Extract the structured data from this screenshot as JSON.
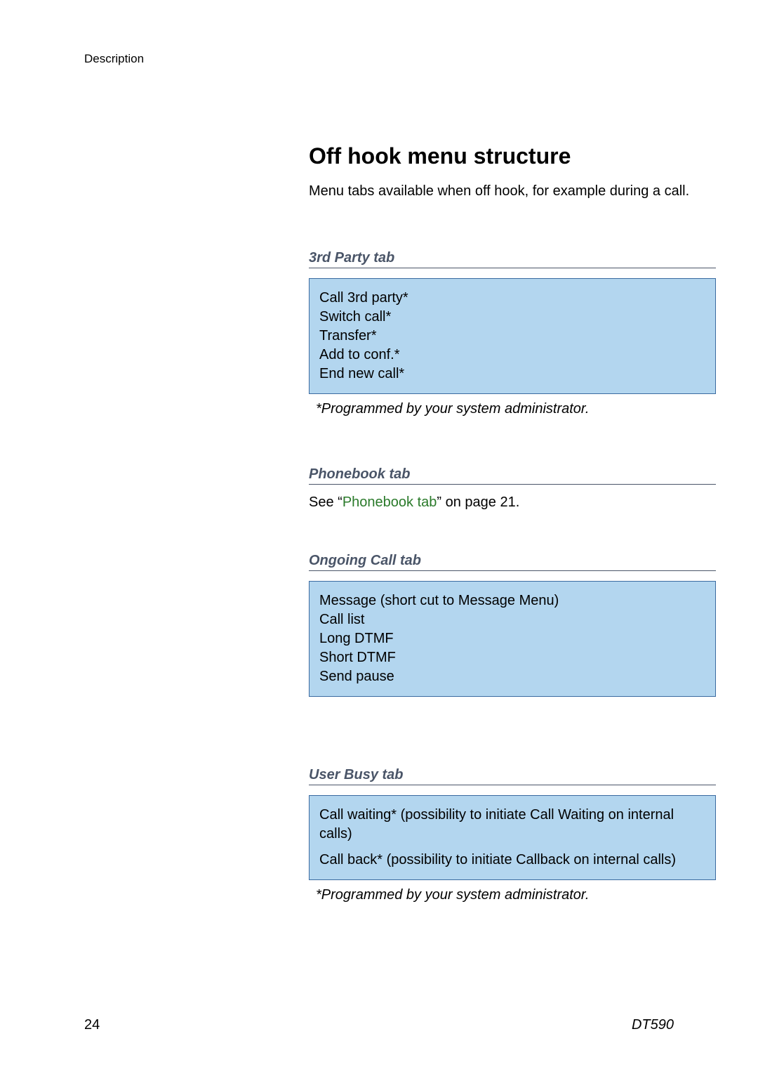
{
  "header": {
    "running": "Description"
  },
  "main": {
    "title": "Off hook menu structure",
    "intro": "Menu tabs available when off hook, for example during a call.",
    "sections": [
      {
        "heading": "3rd Party tab",
        "box_lines": [
          "Call 3rd party*",
          "Switch call*",
          "Transfer*",
          "Add to conf.*",
          "End new call*"
        ],
        "note": "*Programmed by your system administrator."
      },
      {
        "heading": "Phonebook tab",
        "see_pre": "See “",
        "see_link": "Phonebook tab",
        "see_post": "” on page 21."
      },
      {
        "heading": "Ongoing Call tab",
        "box_lines": [
          "Message (short cut to Message Menu)",
          "Call list",
          "Long DTMF",
          "Short DTMF",
          "Send pause"
        ]
      },
      {
        "heading": "User Busy tab",
        "box_lines": [
          "Call waiting* (possibility to initiate Call Waiting on internal calls)",
          "Call back* (possibility to initiate Callback on internal calls)"
        ],
        "note": "*Programmed by your system administrator."
      }
    ]
  },
  "footer": {
    "page": "24",
    "model": "DT590"
  }
}
